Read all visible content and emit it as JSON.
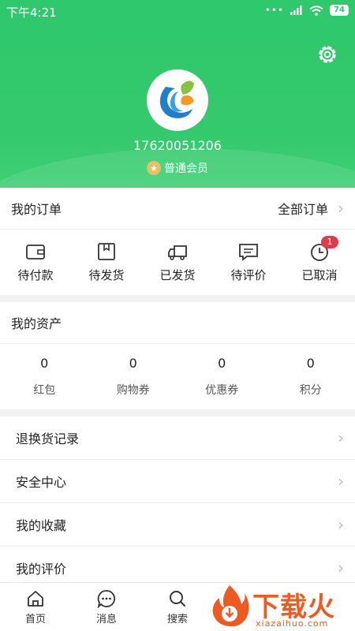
{
  "status_bar": {
    "time": "下午4:21",
    "signal_dots": "•••",
    "battery": "74"
  },
  "profile": {
    "phone": "17620051206",
    "member_level": "普通会员"
  },
  "orders": {
    "title": "我的订单",
    "all_label": "全部订单",
    "items": [
      {
        "label": "待付款",
        "icon": "wallet-icon"
      },
      {
        "label": "待发货",
        "icon": "box-icon"
      },
      {
        "label": "已发货",
        "icon": "truck-icon"
      },
      {
        "label": "待评价",
        "icon": "comment-icon"
      },
      {
        "label": "已取消",
        "icon": "clock-icon",
        "badge": "1"
      }
    ]
  },
  "assets": {
    "title": "我的资产",
    "items": [
      {
        "value": "0",
        "label": "红包"
      },
      {
        "value": "0",
        "label": "购物券"
      },
      {
        "value": "0",
        "label": "优惠券"
      },
      {
        "value": "0",
        "label": "积分"
      }
    ]
  },
  "menu": {
    "items": [
      {
        "label": "退换货记录"
      },
      {
        "label": "安全中心"
      },
      {
        "label": "我的收藏"
      },
      {
        "label": "我的评价"
      }
    ]
  },
  "tabbar": {
    "tabs": [
      {
        "label": "首页",
        "icon": "home-icon"
      },
      {
        "label": "消息",
        "icon": "message-icon"
      },
      {
        "label": "搜索",
        "icon": "search-icon"
      }
    ]
  },
  "watermark": {
    "title": "下载火",
    "url": "xiazaihuo.com"
  },
  "colors": {
    "brand_green": "#2fc86c",
    "badge_red": "#e33a4a",
    "star_gold": "#e7c068",
    "watermark_orange": "#ef5a22"
  }
}
